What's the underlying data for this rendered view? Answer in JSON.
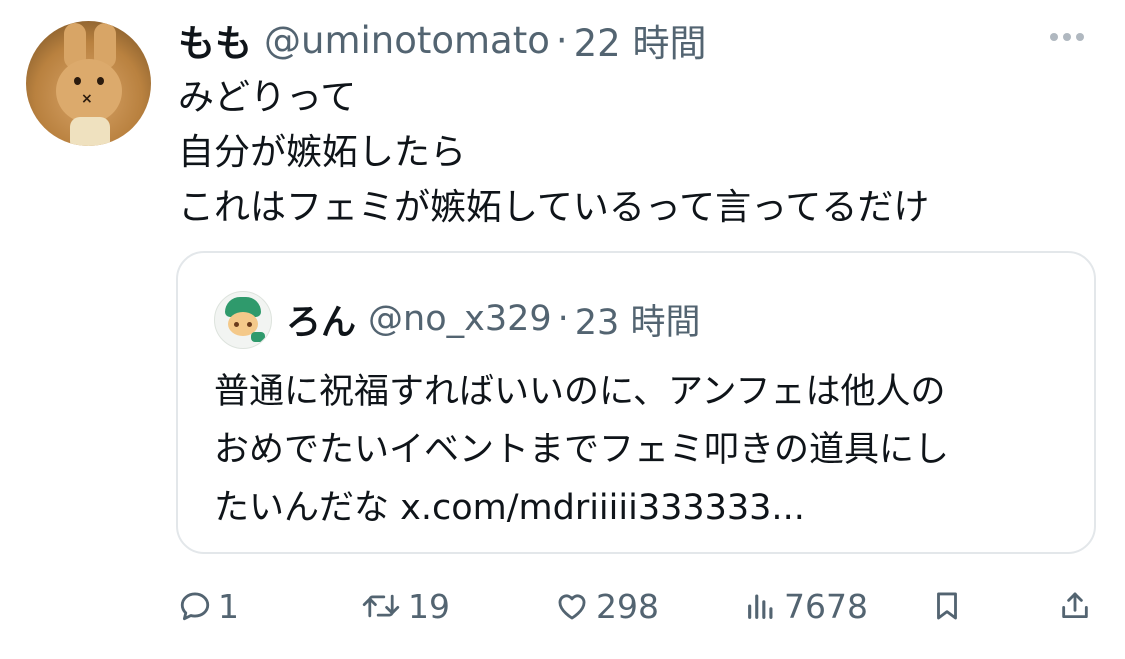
{
  "post": {
    "display_name": "もも",
    "handle": "@uminotomato",
    "separator": "·",
    "timestamp": "22 時間",
    "lines": [
      "みどりって",
      "自分が嫉妬したら",
      "これはフェミが嫉妬しているって言ってるだけ"
    ]
  },
  "quote": {
    "display_name": "ろん",
    "handle": "@no_x329",
    "separator": "·",
    "timestamp": "23 時間",
    "lines": [
      "普通に祝福すればいいのに、アンフェは他人の",
      "おめでたいイベントまでフェミ叩きの道具にし",
      "たいんだな x.com/mdriiiii333333..."
    ]
  },
  "actions": {
    "reply_count": "1",
    "repost_count": "19",
    "like_count": "298",
    "views_count": "7678"
  },
  "icons": {
    "more": "more-horizontal-icon",
    "reply": "reply-icon",
    "repost": "repost-icon",
    "like": "heart-icon",
    "views": "views-icon",
    "bookmark": "bookmark-icon",
    "share": "share-icon"
  },
  "colors": {
    "text_primary": "#0f1419",
    "text_secondary": "#536471",
    "border": "#e3e7ea"
  }
}
